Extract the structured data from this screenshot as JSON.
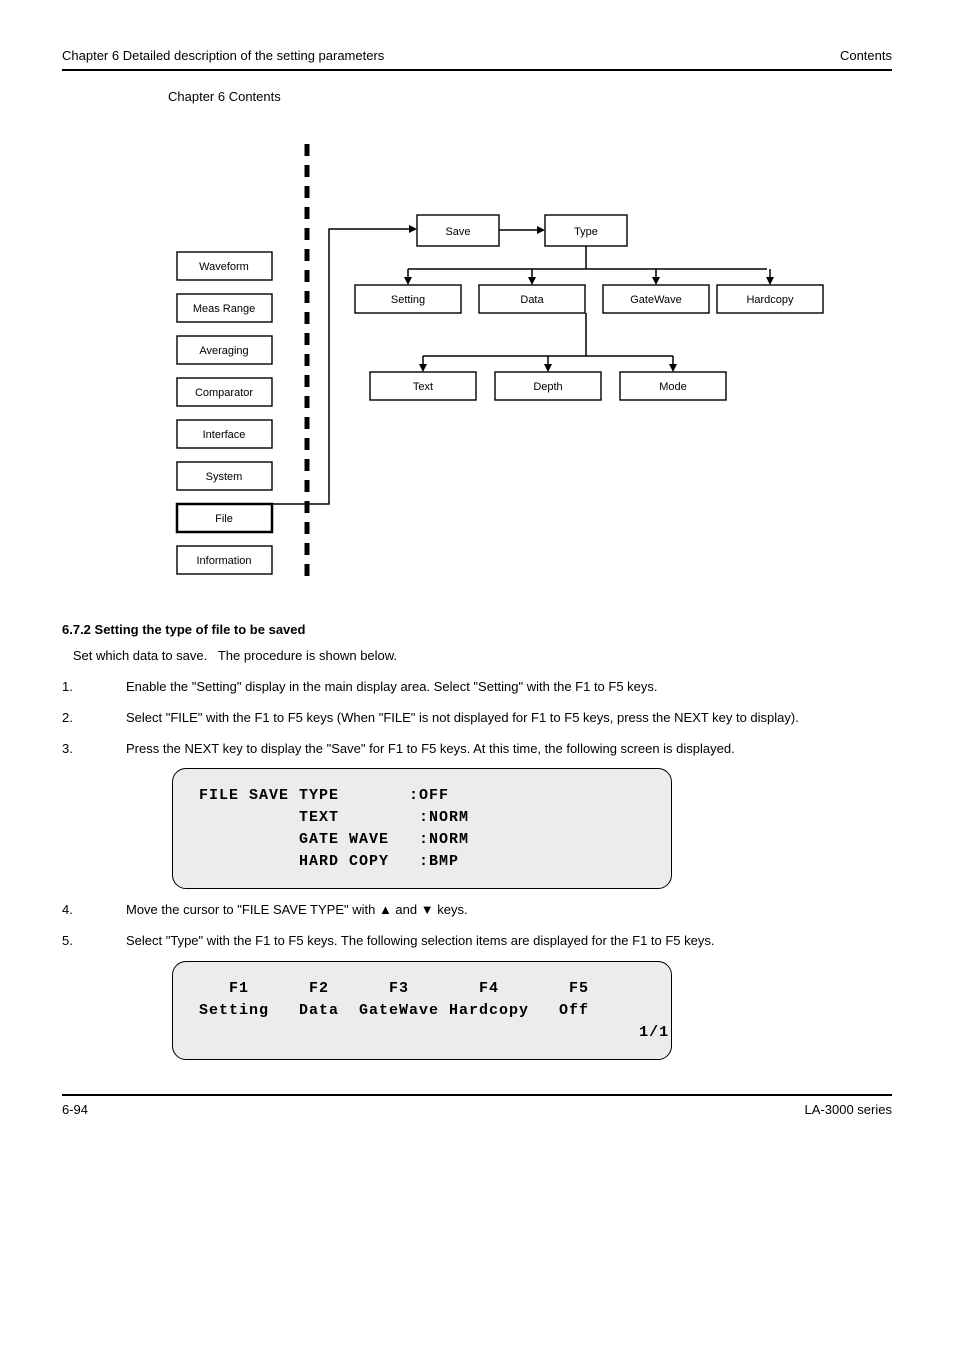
{
  "header": {
    "left": "Chapter 6  Detailed description of the setting parameters",
    "right": "Contents"
  },
  "sidebar": {
    "items": [
      "Waveform",
      "Meas Range",
      "Averaging",
      "Comparator",
      "Interface",
      "System",
      "File",
      "Information"
    ],
    "bold_index": 6
  },
  "flow": {
    "a": "Save",
    "b": "Type",
    "row1": [
      "Setting",
      "Data",
      "GateWave",
      "Hardcopy"
    ],
    "row2": [
      "Text",
      "Depth",
      "Mode"
    ]
  },
  "section": {
    "title": "6.7.2 Setting the type of file to be saved",
    "p": "   Set which data to save.   The procedure is shown below."
  },
  "steps": [
    {
      "n": "1.",
      "t": "Enable the \"Setting\" display in the main display area.  Select \"Setting\" with the F1 to F5 keys."
    },
    {
      "n": "2.",
      "t": "Select \"FILE\" with the F1 to F5 keys (When \"FILE\" is not displayed for F1 to F5 keys, press the NEXT key to display)."
    },
    {
      "n": "3.",
      "t": "Press the NEXT key to display the \"Save\" for F1 to F5 keys. At this time, the following screen is displayed.",
      "disp": [
        "FILE SAVE TYPE       :OFF",
        "          TEXT        :NORM",
        "          GATE WAVE   :NORM",
        "          HARD COPY   :BMP"
      ]
    },
    {
      "n": "4.",
      "t": "Move the cursor to \"FILE SAVE TYPE\" with ▲ and ▼ keys."
    },
    {
      "n": "5.",
      "t": "Select \"Type\" with the F1 to F5 keys. The following selection items are displayed for the F1 to F5 keys.",
      "disp": [
        "   F1      F2      F3       F4       F5",
        "Setting   Data  GateWave Hardcopy   Off",
        "                                            1/1"
      ]
    }
  ],
  "footer": {
    "left": "6-94",
    "right": "LA-3000 series"
  },
  "toc": "Chapter 6 Contents"
}
